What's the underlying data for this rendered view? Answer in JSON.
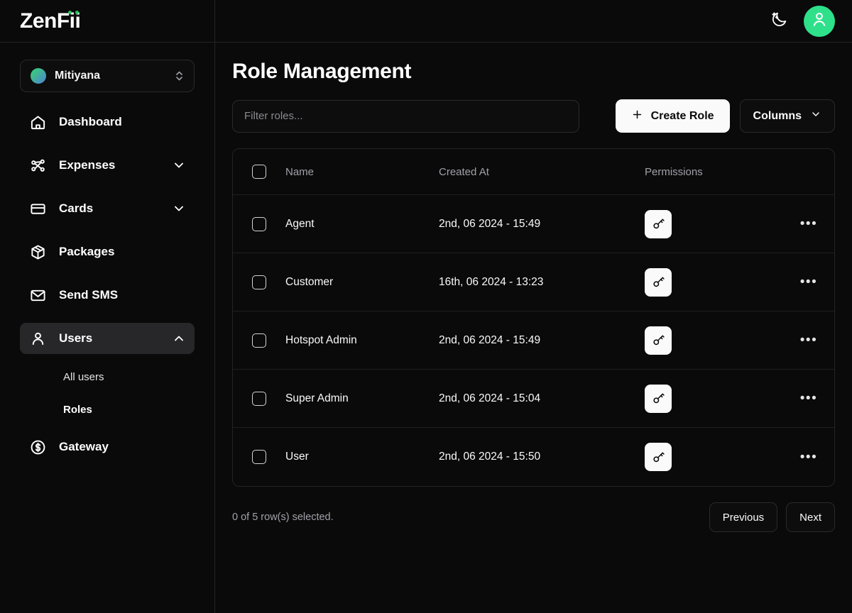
{
  "brand": {
    "name": "ZenFii"
  },
  "sidebar": {
    "org": {
      "name": "Mitiyana",
      "icon": "org-avatar-gradient",
      "chevron": "chevron-up-down-icon"
    },
    "items": [
      {
        "label": "Dashboard",
        "icon": "home-icon",
        "active": false,
        "expandable": false
      },
      {
        "label": "Expenses",
        "icon": "share-network-icon",
        "active": false,
        "expandable": true,
        "chevron": "chevron-down-icon"
      },
      {
        "label": "Cards",
        "icon": "credit-card-icon",
        "active": false,
        "expandable": true,
        "chevron": "chevron-down-icon"
      },
      {
        "label": "Packages",
        "icon": "package-box-icon",
        "active": false,
        "expandable": false
      },
      {
        "label": "Send SMS",
        "icon": "envelope-icon",
        "active": false,
        "expandable": false
      },
      {
        "label": "Users",
        "icon": "user-icon",
        "active": true,
        "expandable": true,
        "chevron": "chevron-up-icon"
      },
      {
        "label": "Gateway",
        "icon": "dollar-circle-icon",
        "active": false,
        "expandable": false
      }
    ],
    "sub_items": [
      {
        "label": "All users",
        "active": false
      },
      {
        "label": "Roles",
        "active": true
      }
    ]
  },
  "topbar": {
    "theme_toggle_icon": "moon-stars-icon",
    "avatar_icon": "user-icon",
    "avatar_color": "#2ee08a"
  },
  "main": {
    "title": "Role Management",
    "search": {
      "placeholder": "Filter roles...",
      "value": ""
    },
    "create_button": {
      "label": "Create Role",
      "icon": "plus-icon"
    },
    "columns_button": {
      "label": "Columns",
      "icon": "chevron-down-icon"
    }
  },
  "table": {
    "headers": [
      "Name",
      "Created At",
      "Permissions"
    ],
    "rows": [
      {
        "name": "Agent",
        "created_at": "2nd, 06 2024 - 15:49",
        "permissions_icon": "key-icon",
        "selected": false
      },
      {
        "name": "Customer",
        "created_at": "16th, 06 2024 - 13:23",
        "permissions_icon": "key-icon",
        "selected": false
      },
      {
        "name": "Hotspot Admin",
        "created_at": "2nd, 06 2024 - 15:49",
        "permissions_icon": "key-icon",
        "selected": false
      },
      {
        "name": "Super Admin",
        "created_at": "2nd, 06 2024 - 15:04",
        "permissions_icon": "key-icon",
        "selected": false
      },
      {
        "name": "User",
        "created_at": "2nd, 06 2024 - 15:50",
        "permissions_icon": "key-icon",
        "selected": false
      }
    ]
  },
  "footer": {
    "selection_text": "0 of 5 row(s) selected.",
    "previous_label": "Previous",
    "next_label": "Next"
  },
  "colors": {
    "background": "#0a0a0a",
    "border": "#242427",
    "accent_green": "#22c55e",
    "avatar_green": "#2ee08a",
    "active_nav": "#272729",
    "muted_text": "#a1a1aa"
  }
}
